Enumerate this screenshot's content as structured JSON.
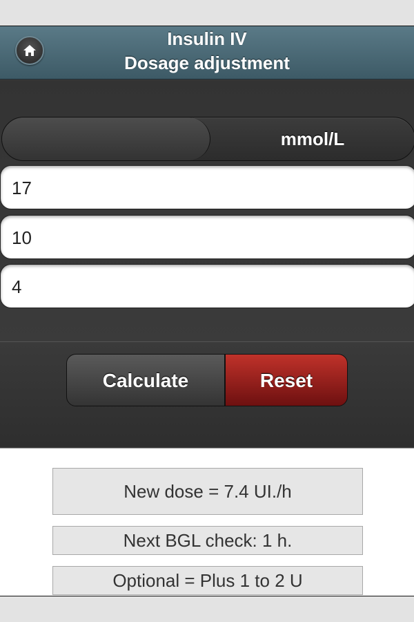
{
  "header": {
    "title_line1": "Insulin IV",
    "title_line2": "Dosage adjustment",
    "home_icon": "home-icon"
  },
  "units": {
    "left_option": "",
    "right_option": "mmol/L",
    "selected": "left"
  },
  "inputs": [
    {
      "value": "17"
    },
    {
      "value": "10"
    },
    {
      "value": "4"
    }
  ],
  "buttons": {
    "calculate": "Calculate",
    "reset": "Reset",
    "reset_color": "#9b1c16"
  },
  "results": {
    "new_dose": "New dose = 7.4 UI./h",
    "next_check": "Next BGL check: 1 h.",
    "optional": "Optional = Plus 1 to 2 U"
  }
}
